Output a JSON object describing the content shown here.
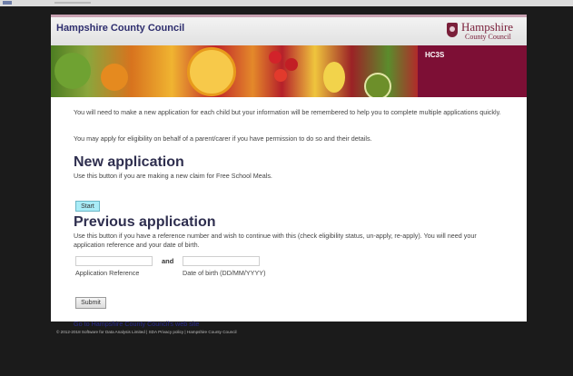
{
  "header": {
    "title": "Hampshire County Council",
    "logo_line1": "Hampshire",
    "logo_line2": "County Council"
  },
  "banner": {
    "tag": "HC3S"
  },
  "intro": {
    "line1": "You will need to make a new application for each child but your information will be remembered to help you to complete multiple applications quickly.",
    "line2": "You may apply for eligibility on behalf of a parent/carer if you have permission to do so and their details."
  },
  "new_application": {
    "heading": "New application",
    "description": "Use this button if you are making a new claim for Free School Meals.",
    "button_label": "Start"
  },
  "previous_application": {
    "heading": "Previous application",
    "description": "Use this button if you have a reference number and wish to continue with this (check eligibility status, un-apply, re-apply). You will need your application reference and your date of birth.",
    "reference_label": "Application Reference",
    "and_label": "and",
    "dob_label": "Date of birth (DD/MM/YYYY)",
    "reference_value": "",
    "dob_value": "",
    "button_label": "Submit"
  },
  "link": {
    "text": "Go to Hampshire County Council's web site"
  },
  "footer": {
    "text": "© 2012-2018 Software for Data Analysis Limited | SDA Privacy policy | Hampshire County Council"
  },
  "colors": {
    "plum": "#7d0f35",
    "heading": "#2f2f4f",
    "link": "#2b2b8e",
    "start_button": "#a9ecf7"
  }
}
